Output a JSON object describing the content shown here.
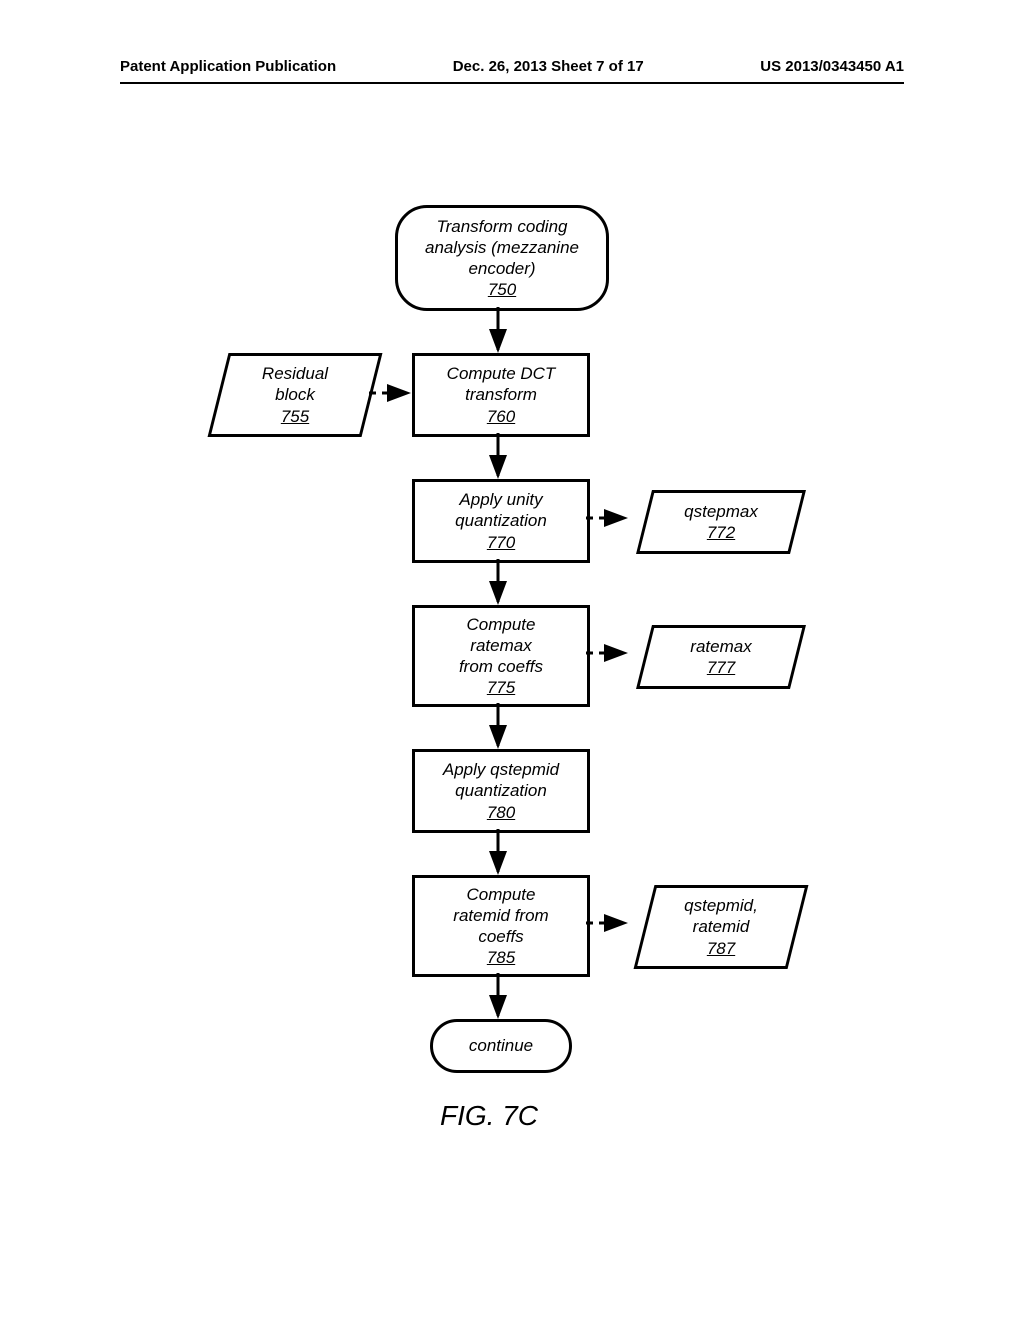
{
  "header": {
    "left": "Patent Application Publication",
    "middle": "Dec. 26, 2013   Sheet 7 of 17",
    "right": "US 2013/0343450 A1"
  },
  "nodes": {
    "n750_l1": "Transform coding",
    "n750_l2": "analysis (mezzanine",
    "n750_l3": "encoder)",
    "n750_num": "750",
    "n755_l1": "Residual",
    "n755_l2": "block",
    "n755_num": "755",
    "n760_l1": "Compute DCT",
    "n760_l2": "transform",
    "n760_num": "760",
    "n770_l1": "Apply unity",
    "n770_l2": "quantization",
    "n770_num": "770",
    "n772_l1": "qstepmax",
    "n772_num": "772",
    "n775_l1": "Compute",
    "n775_l2": "ratemax",
    "n775_l3": "from coeffs",
    "n775_num": "775",
    "n777_l1": "ratemax",
    "n777_num": "777",
    "n780_l1": "Apply qstepmid",
    "n780_l2": "quantization",
    "n780_num": "780",
    "n785_l1": "Compute",
    "n785_l2": "ratemid from",
    "n785_l3": "coeffs",
    "n785_num": "785",
    "n787_l1": "qstepmid,",
    "n787_l2": "ratemid",
    "n787_num": "787",
    "continue": "continue"
  },
  "figure_caption": "FIG. 7C"
}
